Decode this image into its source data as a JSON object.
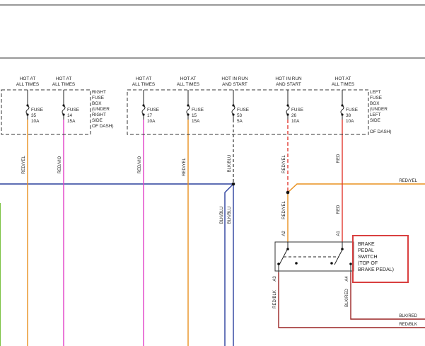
{
  "colors": {
    "red": "#e03a30",
    "orange": "#e8901e",
    "magenta": "#e040c8",
    "blue": "#2a3e9c",
    "dark_red": "#9a2424",
    "green": "#7bc242",
    "highlight": "#d94040",
    "ink": "#333333"
  },
  "headers": {
    "f35_line1": "HOT AT",
    "f35_line2": "ALL TIMES",
    "f14_line1": "HOT AT",
    "f14_line2": "ALL TIMES",
    "f17_line1": "HOT AT",
    "f17_line2": "ALL TIMES",
    "f15_line1": "HOT AT",
    "f15_line2": "ALL TIMES",
    "f53_line1": "HOT IN RUN",
    "f53_line2": "AND START",
    "f26_line1": "HOT IN RUN",
    "f26_line2": "AND START",
    "f38_line1": "HOT AT",
    "f38_line2": "ALL TIMES"
  },
  "fuses": {
    "f35": {
      "word": "FUSE",
      "num": "35",
      "amp": "10A"
    },
    "f14": {
      "word": "FUSE",
      "num": "14",
      "amp": "15A"
    },
    "f17": {
      "word": "FUSE",
      "num": "17",
      "amp": "10A"
    },
    "f15": {
      "word": "FUSE",
      "num": "15",
      "amp": "15A"
    },
    "f53": {
      "word": "FUSE",
      "num": "53",
      "amp": "5A"
    },
    "f26": {
      "word": "FUSE",
      "num": "26",
      "amp": "10A"
    },
    "f38": {
      "word": "FUSE",
      "num": "38",
      "amp": "10A"
    }
  },
  "right_box": {
    "l1": "RIGHT",
    "l2": "FUSE",
    "l3": "BOX",
    "l4": "(UNDER",
    "l5": "RIGHT",
    "l6": "SIDE",
    "l7": "OF DASH)"
  },
  "left_box": {
    "l1": "LEFT",
    "l2": "FUSE",
    "l3": "BOX",
    "l4": "(UNDER",
    "l5": "LEFT",
    "l6": "SIDE",
    "l7": "OF DASH)"
  },
  "wires": {
    "f35": "RED/YEL",
    "f14": "RED/VIO",
    "f17": "RED/VIO",
    "f15": "RED/YEL",
    "f53": "BLK/BLU",
    "f26": "RED/YEL",
    "f38": "RED",
    "right_top": "RED/YEL",
    "blk_blu_a": "BLK/BLU",
    "blk_blu_b": "BLK/BLU",
    "a2_wire": "RED/YEL",
    "a1_wire": "RED",
    "a3_wire": "RED/BLK",
    "a4_wire": "BLK/RED",
    "right_blk_red": "BLK/RED",
    "right_red_blk": "RED/BLK"
  },
  "switch": {
    "pin_a2": "A2",
    "pin_a1": "A1",
    "pin_a3": "A3",
    "pin_a4": "A4",
    "l1": "BRAKE",
    "l2": "PEDAL",
    "l3": "SWITCH",
    "l4": "(TOP OF",
    "l5": "BRAKE PEDAL)"
  }
}
